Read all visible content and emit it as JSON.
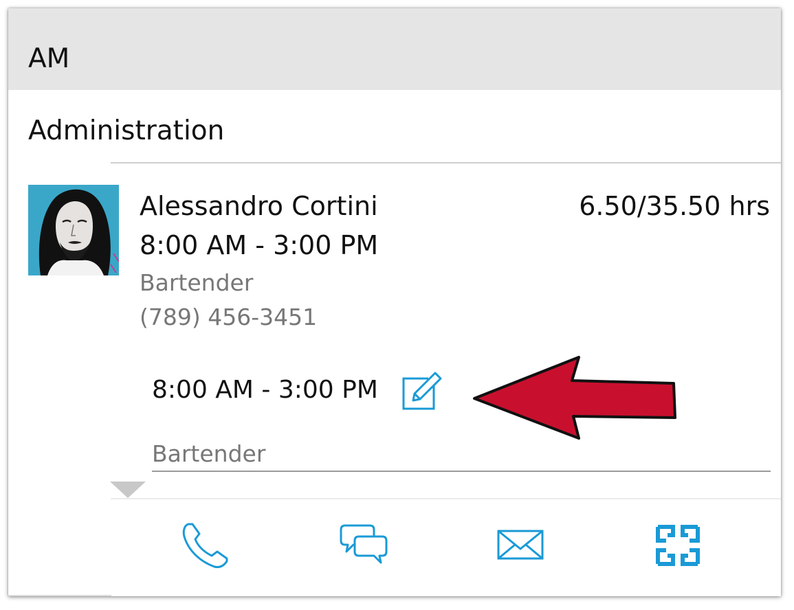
{
  "section": {
    "title": "AM"
  },
  "department": {
    "name": "Administration"
  },
  "employee": {
    "name": "Alessandro Cortini",
    "hours": "6.50/35.50 hrs",
    "shift_time": "8:00 AM - 3:00 PM",
    "role": "Bartender",
    "phone": "(789) 456-3451",
    "avatar_icon": "avatar"
  },
  "shift": {
    "time": "8:00 AM - 3:00 PM",
    "role": "Bartender",
    "edit_icon": "edit-icon"
  },
  "actions": [
    {
      "icon": "phone-icon"
    },
    {
      "icon": "chat-icon"
    },
    {
      "icon": "mail-icon"
    },
    {
      "icon": "exchange-icon"
    }
  ],
  "colors": {
    "accent": "#1a9ad6",
    "header_bg": "#e5e5e5",
    "secondary_text": "#777777",
    "arrow": "#c8102e"
  }
}
